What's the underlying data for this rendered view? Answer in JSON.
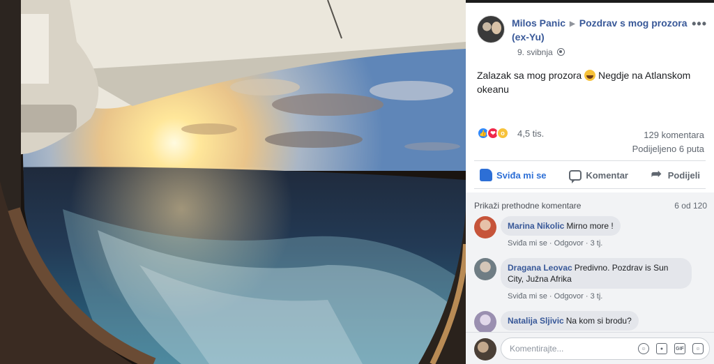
{
  "post": {
    "author": "Milos Panic",
    "group": "Pozdrav s mog prozora (ex-Yu)",
    "date": "9. svibnja",
    "text": "Zalazak sa mog prozora",
    "text_after_emoji": "Negdje na Atlanskom okeanu",
    "more_icon": "•••",
    "privacy_icon": "globe-icon"
  },
  "reactions": {
    "count": "4,5 tis.",
    "types": [
      "like",
      "love",
      "wow"
    ]
  },
  "stats": {
    "comments": "129 komentara",
    "shares": "Podijeljeno 6 puta"
  },
  "actions": {
    "like": "Sviđa mi se",
    "comment": "Komentar",
    "share": "Podijeli"
  },
  "comments_header": {
    "previous": "Prikaži prethodne komentare",
    "count": "6 od 120"
  },
  "comments": [
    {
      "name": "Marina Nikolic",
      "text": "Mirno more !",
      "like_label": "Sviđa mi se",
      "reply_label": "Odgovor",
      "age": "3 tj.",
      "avatar_color": "#c6543a"
    },
    {
      "name": "Dragana Leovac",
      "text": "Predivno. Pozdrav is Sun City, Južna Afrika",
      "like_label": "Sviđa mi se",
      "reply_label": "Odgovor",
      "age": "3 tj.",
      "avatar_color": "#6f7d84"
    },
    {
      "name": "Natalija Sljivic",
      "text": "Na kom si brodu?",
      "avatar_color": "#9a8fb0"
    }
  ],
  "composer": {
    "placeholder": "Komentirajte..."
  },
  "colors": {
    "link": "#385898",
    "like_active": "#2d6fd6",
    "panel_bg": "#ffffff",
    "comments_bg": "#f2f3f5"
  }
}
